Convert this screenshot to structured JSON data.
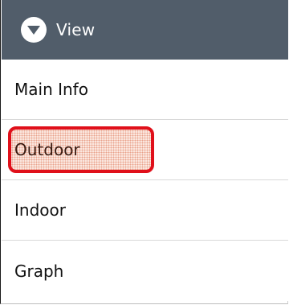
{
  "header": {
    "title": "View",
    "icon": "chevron-down-circle-icon",
    "background": "#515d6a"
  },
  "menu": {
    "items": [
      {
        "label": "Main Info",
        "highlighted": false
      },
      {
        "label": "Outdoor",
        "highlighted": true
      },
      {
        "label": "Indoor",
        "highlighted": false
      },
      {
        "label": "Graph",
        "highlighted": false
      }
    ],
    "highlight_color": "#e0101a"
  }
}
